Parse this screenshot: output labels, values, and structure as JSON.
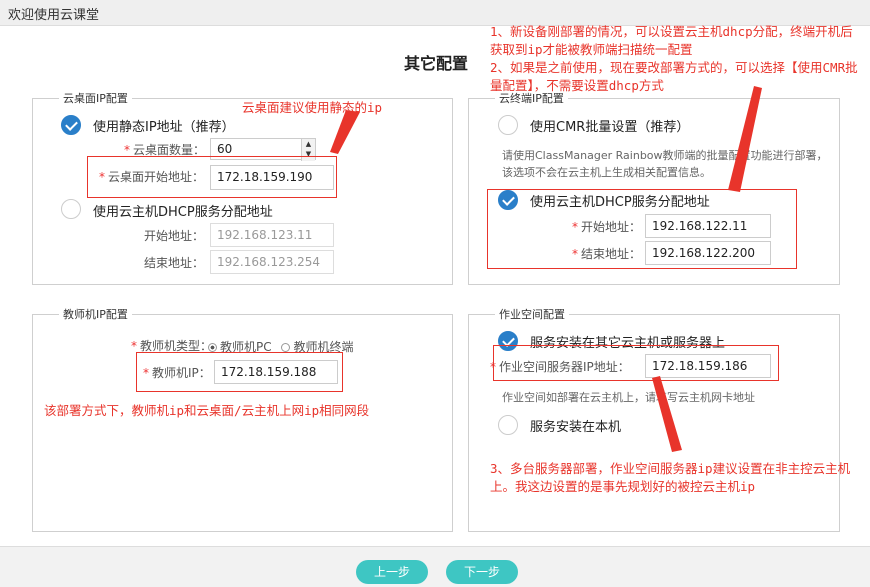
{
  "window": {
    "title": "欢迎使用云课堂"
  },
  "page": {
    "title": "其它配置"
  },
  "desktop_ip": {
    "legend": "云桌面IP配置",
    "static_option": "使用静态IP地址（推荐）",
    "count_label": "云桌面数量：",
    "count_value": "60",
    "start_label": "云桌面开始地址：",
    "start_value": "172.18.159.190",
    "dhcp_option": "使用云主机DHCP服务分配地址",
    "dhcp_start_label": "开始地址：",
    "dhcp_start_value": "192.168.123.11",
    "dhcp_end_label": "结束地址：",
    "dhcp_end_value": "192.168.123.254"
  },
  "terminal_ip": {
    "legend": "云终端IP配置",
    "cmr_option": "使用CMR批量设置（推荐）",
    "note": "请使用ClassManager Rainbow教师端的批量配置功能进行部署，该选项不会在云主机上生成相关配置信息。",
    "dhcp_option": "使用云主机DHCP服务分配地址",
    "start_label": "开始地址：",
    "start_value": "192.168.122.11",
    "end_label": "结束地址：",
    "end_value": "192.168.122.200"
  },
  "teacher_ip": {
    "legend": "教师机IP配置",
    "type_label": "教师机类型：",
    "type_pc": "教师机PC",
    "type_terminal": "教师机终端",
    "ip_label": "教师机IP：",
    "ip_value": "172.18.159.188"
  },
  "workspace": {
    "legend": "作业空间配置",
    "other_option": "服务安装在其它云主机或服务器上",
    "server_label": "作业空间服务器IP地址：",
    "server_value": "172.18.159.186",
    "note": "作业空间如部署在云主机上，请填写云主机网卡地址",
    "local_option": "服务安装在本机"
  },
  "annotations": {
    "top_right": "1、新设备刚部署的情况，可以设置云主机dhcp分配，终端开机后获取到ip才能被教师端扫描统一配置\n2、如果是之前使用，现在要改部署方式的，可以选择【使用CMR批量配置】，不需要设置dhcp方式",
    "desktop": "云桌面建议使用静态的ip",
    "teacher": "该部署方式下，教师机ip和云桌面/云主机上网ip相同网段",
    "workspace": "3、多台服务器部署，作业空间服务器ip建议设置在非主控云主机上。我这边设置的是事先规划好的被控云主机ip"
  },
  "buttons": {
    "prev": "上一步",
    "next": "下一步"
  },
  "colors": {
    "accent": "#2a7fc9",
    "button": "#3ec6c3",
    "annotation": "#e8342b"
  }
}
